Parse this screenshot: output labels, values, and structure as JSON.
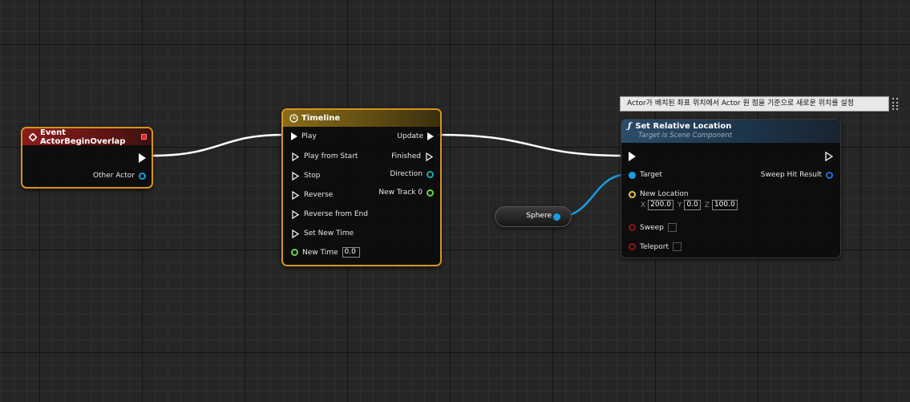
{
  "event_node": {
    "title": "Event ActorBeginOverlap",
    "pins": {
      "other_actor": "Other Actor"
    }
  },
  "timeline_node": {
    "title": "Timeline",
    "inputs": {
      "play": "Play",
      "play_from_start": "Play from Start",
      "stop": "Stop",
      "reverse": "Reverse",
      "reverse_from_end": "Reverse from End",
      "set_new_time": "Set New Time",
      "new_time": "New Time"
    },
    "new_time_value": "0.0",
    "outputs": {
      "update": "Update",
      "finished": "Finished",
      "direction": "Direction",
      "new_track": "New Track 0"
    }
  },
  "variable_node": {
    "label": "Sphere"
  },
  "comment_bubble": {
    "text": "Actor가 배치된 좌표 위치에서 Actor 원 점을 기준으로 새로운 위치를 설정"
  },
  "set_location_node": {
    "title": "Set Relative Location",
    "subtitle": "Target is Scene Component",
    "pins": {
      "target": "Target",
      "sweep_hit_result": "Sweep Hit Result",
      "new_location": "New Location",
      "sweep": "Sweep",
      "teleport": "Teleport"
    },
    "new_location": {
      "x_label": "X",
      "x": "200.0",
      "y_label": "Y",
      "y": "0.0",
      "z_label": "Z",
      "z": "100.0"
    }
  },
  "colors": {
    "exec": "#ffffff",
    "object_pin": "#1a9de4",
    "vector_pin": "#e8c24b",
    "bool_pin": "#8c1414",
    "float_pin": "#6cd04e",
    "struct_pin": "#1fa9a9",
    "selection": "#d7931c",
    "event_header": "#8b1c1c",
    "timeline_header": "#6b5412",
    "function_header": "#2b4d6b"
  },
  "icons": {
    "event": "event-diamond-icon",
    "timeline": "clock-icon",
    "function": "function-f-icon"
  }
}
